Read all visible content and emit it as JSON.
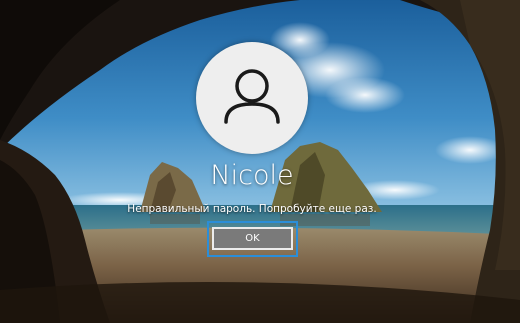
{
  "login": {
    "user_name": "Nicole",
    "error_message": "Неправильный пароль. Попробуйте еще раз.",
    "ok_label": "OK"
  },
  "icons": {
    "avatar": "user-silhouette-icon"
  },
  "colors": {
    "focus_ring": "#2b8ed8",
    "button_bg": "#7a7a7a",
    "avatar_bg": "#eeeeee"
  }
}
